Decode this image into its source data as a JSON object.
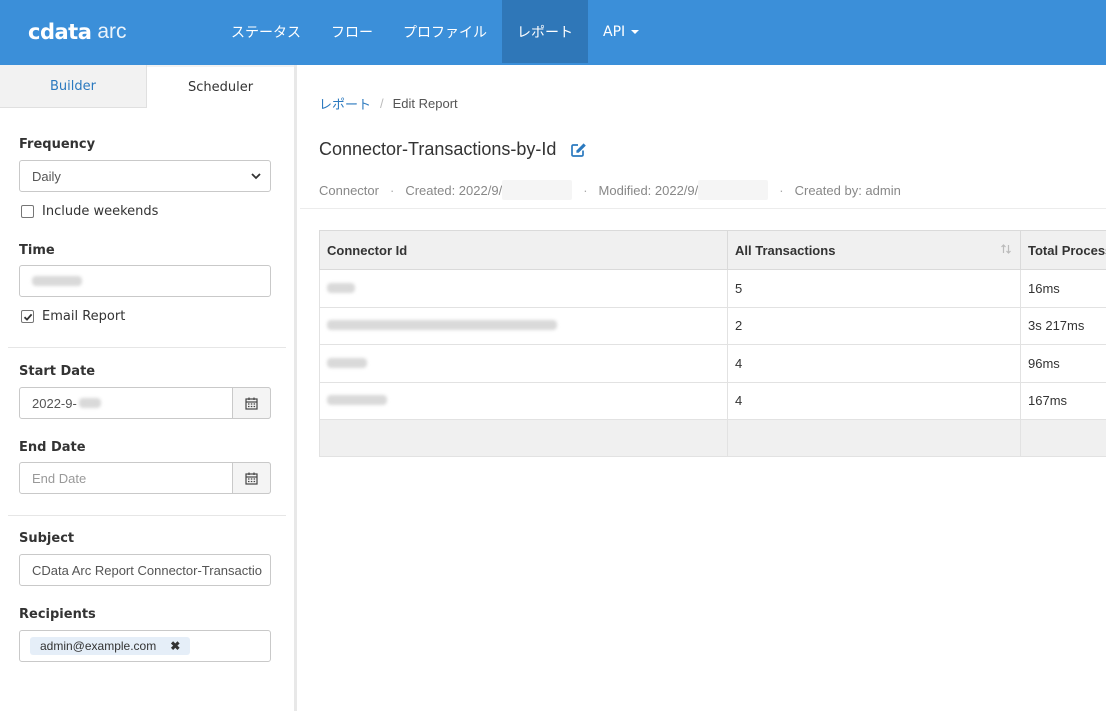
{
  "app": {
    "logo_mark": "cdata",
    "logo_word": "arc"
  },
  "nav": {
    "items": [
      {
        "label": "ステータス",
        "active": false
      },
      {
        "label": "フロー",
        "active": false
      },
      {
        "label": "プロファイル",
        "active": false
      },
      {
        "label": "レポート",
        "active": true
      },
      {
        "label": "API",
        "active": false,
        "dropdown": true
      }
    ]
  },
  "sidebar": {
    "tabs": [
      {
        "label": "Builder",
        "active": false
      },
      {
        "label": "Scheduler",
        "active": true
      }
    ],
    "frequency": {
      "label": "Frequency",
      "value": "Daily",
      "include_weekends_label": "Include weekends",
      "include_weekends_checked": false
    },
    "time": {
      "label": "Time",
      "value": "",
      "email_report_label": "Email Report",
      "email_report_checked": true
    },
    "start_date": {
      "label": "Start Date",
      "value": "2022-9-"
    },
    "end_date": {
      "label": "End Date",
      "placeholder": "End Date"
    },
    "subject": {
      "label": "Subject",
      "value": "CData Arc Report Connector-Transactio"
    },
    "recipients": {
      "label": "Recipients",
      "tags": [
        "admin@example.com"
      ]
    }
  },
  "main": {
    "breadcrumb": {
      "parent": "レポート",
      "current": "Edit Report"
    },
    "title": "Connector-Transactions-by-Id",
    "meta": {
      "type": "Connector",
      "created": "Created: 2022/9/",
      "modified": "Modified: 2022/9/",
      "created_by": "Created by: admin"
    },
    "table": {
      "columns": [
        "Connector Id",
        "All Transactions",
        "Total Process"
      ],
      "rows": [
        {
          "connector_id": "",
          "all_transactions": "5",
          "total_process": "16ms"
        },
        {
          "connector_id": "",
          "all_transactions": "2",
          "total_process": "3s 217ms"
        },
        {
          "connector_id": "",
          "all_transactions": "4",
          "total_process": "96ms"
        },
        {
          "connector_id": "",
          "all_transactions": "4",
          "total_process": "167ms"
        }
      ]
    }
  },
  "colors": {
    "topbar": "#3b8fd9",
    "topbar_active": "#2f77b8",
    "link": "#2b79bf"
  },
  "icons": {
    "edit": "edit-icon",
    "calendar": "calendar-icon",
    "sort": "sort-icon",
    "remove": "close-icon",
    "select": "chevron-down-icon"
  }
}
